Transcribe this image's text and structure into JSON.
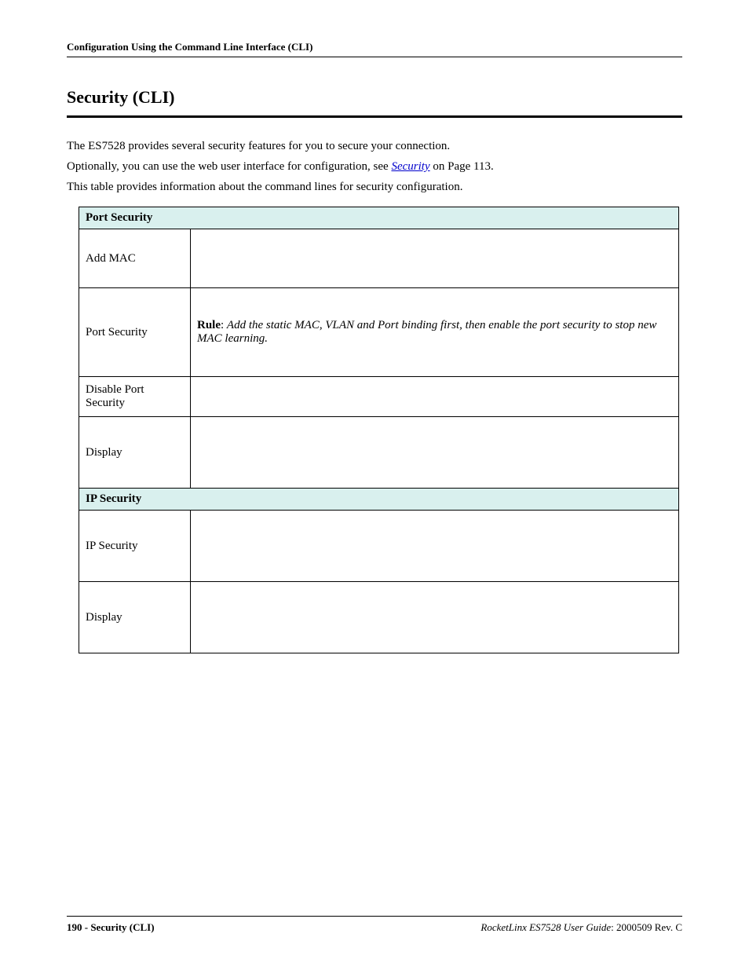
{
  "header": {
    "running": "Configuration Using the Command Line Interface (CLI)"
  },
  "title": "Security (CLI)",
  "intro": {
    "p1": "The ES7528 provides several security features for you to secure your connection.",
    "p2_pre": "Optionally, you can use the web user interface for configuration, see ",
    "p2_link": "Security",
    "p2_post": " on Page 113.",
    "p3": "This table provides information about the command lines for security configuration."
  },
  "table": {
    "section1": "Port Security",
    "rows1": {
      "r1_label": "Add MAC",
      "r2_label": "Port Security",
      "r2_rule_label": "Rule",
      "r2_rule_sep": ": ",
      "r2_rule_text": "Add the static MAC, VLAN and Port binding first, then enable the port security to stop new MAC learning.",
      "r3_label": "Disable Port Security",
      "r4_label": "Display"
    },
    "section2": "IP Security",
    "rows2": {
      "r1_label": "IP Security",
      "r2_label": "Display"
    }
  },
  "footer": {
    "left_page": "190 - Security (CLI)",
    "right_product": "RocketLinx ES7528  User Guide",
    "right_sep": ": ",
    "right_rev": "2000509 Rev. C"
  }
}
